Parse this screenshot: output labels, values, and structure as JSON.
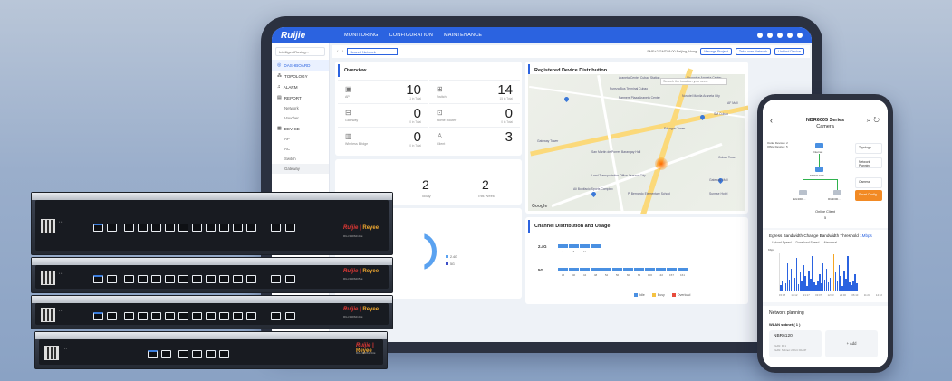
{
  "tablet": {
    "logo": "Ruijie",
    "nav": [
      "MONITORING",
      "CONFIGURATION",
      "MAINTENANCE"
    ],
    "sidebar": {
      "search": "IntelligentRoving...",
      "items": [
        {
          "label": "DASHBOARD",
          "icon": "dashboard-icon"
        },
        {
          "label": "TOPOLOGY",
          "icon": "topology-icon"
        },
        {
          "label": "ALARM",
          "icon": "alarm-icon"
        },
        {
          "label": "REPORT",
          "icon": "report-icon"
        }
      ],
      "report_sub": [
        "Network",
        "Voucher"
      ],
      "device_label": "DEVICE",
      "device_sub": [
        "AP",
        "AC",
        "Switch",
        "Gateway"
      ]
    },
    "crumb": {
      "search_placeholder": "Search Network",
      "location": "SMF+2/GMT08:00 Beijing, Hong",
      "buttons": [
        "Manage Project",
        "Take over Network",
        "Unbind Device"
      ]
    },
    "overview": {
      "title": "Overview",
      "cells": [
        {
          "name": "AP",
          "value": "10",
          "total": "11 in Total",
          "icon": "ap-icon"
        },
        {
          "name": "Switch",
          "value": "14",
          "total": "15 in Total",
          "icon": "switch-icon"
        },
        {
          "name": "Gateway",
          "value": "0",
          "total": "0 in Total",
          "icon": "gateway-icon"
        },
        {
          "name": "Home Router",
          "value": "0",
          "total": "0 in Total",
          "icon": "home-router-icon"
        },
        {
          "name": "Wireless Bridge",
          "value": "0",
          "total": "0 in Total",
          "icon": "bridge-icon"
        },
        {
          "name": "Client",
          "value": "3",
          "total": "",
          "icon": "client-icon"
        }
      ]
    },
    "map": {
      "title": "Registered Device Distribution",
      "search_placeholder": "Search the location you need.",
      "labels": [
        "Pureza Bus Terminal Cubao",
        "Farmers Plaza Araneta Center",
        "Shopwise Araneta Center",
        "Novotel Manila Araneta City",
        "Araneta Center Cubao Station",
        "AF Mall",
        "SM Cubao",
        "Edsagon Tower",
        "Gateway Tower",
        "San Martin de Porres Barangay Hall",
        "Land Transportation Office Quezon City",
        "Ali Bonifacio Sports Complex",
        "Cubao Tower",
        "Gateway Mall",
        "Sunrise Hotel",
        "P. Bernardo Elementary School"
      ],
      "google": "Google"
    },
    "stats": [
      {
        "value": "2",
        "label": "Today"
      },
      {
        "value": "2",
        "label": "This Week"
      }
    ],
    "donut_legend": [
      "2.4G",
      "5G"
    ],
    "channel": {
      "title": "Channel Distribution and Usage",
      "band24": "2.4G",
      "band5": "5G",
      "ticks24": [
        "1",
        "6",
        "11"
      ],
      "ticks5": [
        "36",
        "40",
        "44",
        "48",
        "52",
        "56",
        "60",
        "64",
        "100",
        "132",
        "157",
        "161"
      ],
      "legend": [
        "Idle",
        "Busy",
        "Overload"
      ]
    }
  },
  "phone": {
    "title": "NBR6005 Series",
    "subtitle": "Camera",
    "location": "Outlet Devices: 2 Office Devices: 5",
    "topo_labels": [
      "Internet",
      "NBR6120-E",
      "EG3000...",
      "RG3000..."
    ],
    "side_buttons": [
      "Topology",
      "Network Planning",
      "Camera",
      "Smart Config"
    ],
    "online_label": "Online Client",
    "online_count": "5",
    "bandwidth": {
      "title": "Egress Bandwidth",
      "change": "Change Bandwidth",
      "threshold_label": "Threshold",
      "threshold_value": "1Mbps",
      "legend": [
        "Upload Speed",
        "Download Speed",
        "Abnormal"
      ],
      "unit": "Kbps",
      "ticks": [
        "15:08",
        "16:12",
        "21:17",
        "03:07",
        "12:03",
        "23:46",
        "06:10",
        "11:23",
        "14:22"
      ]
    },
    "network_planning": {
      "title": "Network planning",
      "vlan": "WLAN subnet ( 1 )",
      "card_name": "NBR6120",
      "card_lines": [
        "VLAN: ID 1",
        "VLAN: Subnet: 2 Port: DHCP"
      ],
      "add": "+ Add"
    }
  },
  "routers": [
    {
      "brand": "Ruijie",
      "sub": "Reyee",
      "model": "RG-NBR6210-E"
    },
    {
      "brand": "Ruijie",
      "sub": "Reyee",
      "model": "RG-NBR6205-E"
    },
    {
      "brand": "Ruijie",
      "sub": "Reyee",
      "model": "RG-NBR6210-E"
    },
    {
      "brand": "Ruijie",
      "sub": "Reyee",
      "model": "RG-NBR6120-E"
    }
  ],
  "colors": {
    "accent": "#2b63e0",
    "bandwidth": "#2b63e0",
    "orange": "#f28a24",
    "hotspot": "#ff6a00"
  }
}
